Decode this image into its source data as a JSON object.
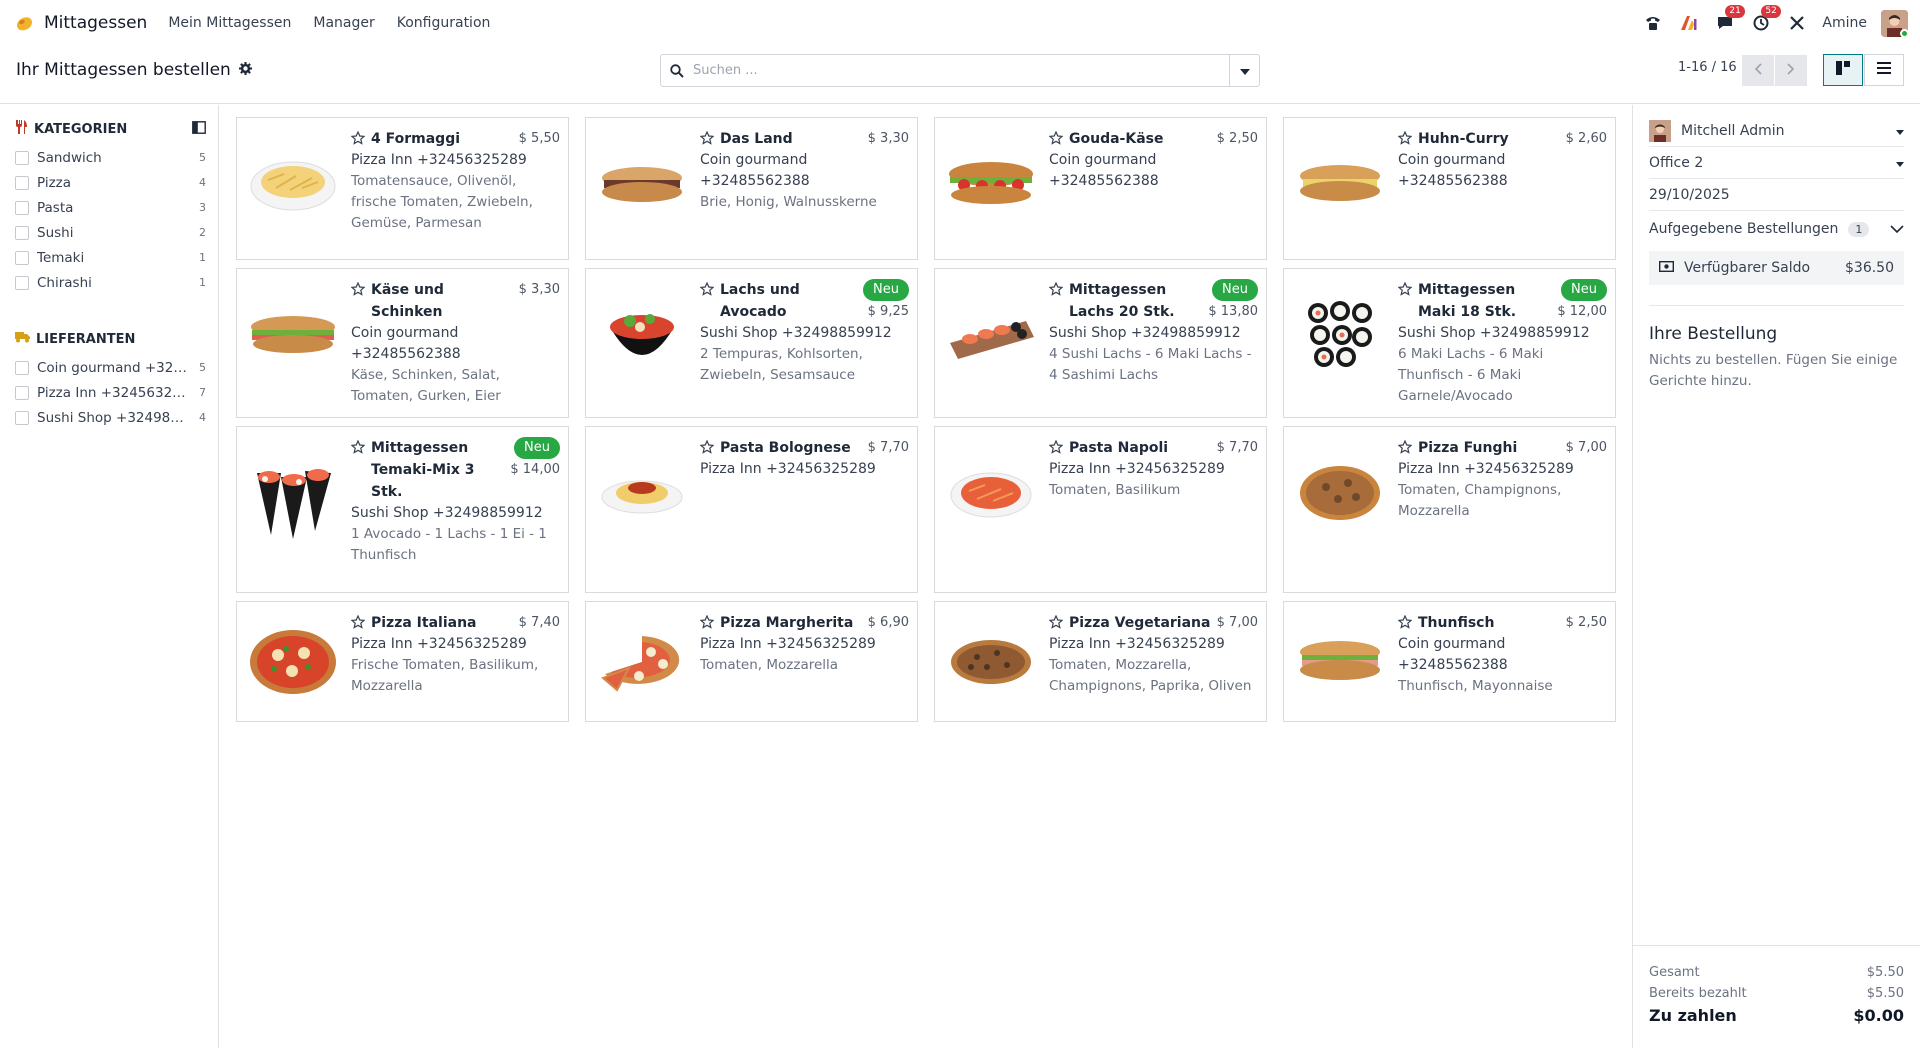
{
  "navbar": {
    "app_name": "Mittagessen",
    "menu": [
      "Mein Mittagessen",
      "Manager",
      "Konfiguration"
    ],
    "messages_count": "21",
    "activities_count": "52",
    "user_name": "Amine"
  },
  "control": {
    "title": "Ihr Mittagessen bestellen",
    "search_placeholder": "Suchen ...",
    "pager": "1-16 / 16"
  },
  "sidebar": {
    "categories_title": "KATEGORIEN",
    "categories": [
      {
        "label": "Sandwich",
        "count": "5"
      },
      {
        "label": "Pizza",
        "count": "4"
      },
      {
        "label": "Pasta",
        "count": "3"
      },
      {
        "label": "Sushi",
        "count": "2"
      },
      {
        "label": "Temaki",
        "count": "1"
      },
      {
        "label": "Chirashi",
        "count": "1"
      }
    ],
    "suppliers_title": "LIEFERANTEN",
    "suppliers": [
      {
        "label": "Coin gourmand +3248...",
        "count": "5"
      },
      {
        "label": "Pizza Inn +32456325289",
        "count": "7"
      },
      {
        "label": "Sushi Shop +3249885...",
        "count": "4"
      }
    ]
  },
  "products": [
    {
      "name": "4 Formaggi",
      "price": "$ 5,50",
      "new": "",
      "vendor": "Pizza Inn +32456325289",
      "desc": "Tomatensauce, Olivenöl, frische Tomaten, Zwiebeln, Gemüse, Parmesan"
    },
    {
      "name": "Das Land",
      "price": "$ 3,30",
      "new": "",
      "vendor": "Coin gourmand +32485562388",
      "desc": "Brie, Honig, Walnusskerne"
    },
    {
      "name": "Gouda-Käse",
      "price": "$ 2,50",
      "new": "",
      "vendor": "Coin gourmand +32485562388",
      "desc": ""
    },
    {
      "name": "Huhn-Curry",
      "price": "$ 2,60",
      "new": "",
      "vendor": "Coin gourmand +32485562388",
      "desc": ""
    },
    {
      "name": "Käse und Schinken",
      "price": "$ 3,30",
      "new": "",
      "vendor": "Coin gourmand +32485562388",
      "desc": "Käse, Schinken, Salat, Tomaten, Gurken, Eier"
    },
    {
      "name": "Lachs und Avocado",
      "price": "$ 9,25",
      "new": "Neu",
      "vendor": "Sushi Shop +32498859912",
      "desc": "2 Tempuras, Kohlsorten, Zwiebeln, Sesamsauce"
    },
    {
      "name": "Mittagessen Lachs 20 Stk.",
      "price": "$ 13,80",
      "new": "Neu",
      "vendor": "Sushi Shop +32498859912",
      "desc": "4 Sushi Lachs - 6 Maki Lachs - 4 Sashimi Lachs"
    },
    {
      "name": "Mittagessen Maki 18 Stk.",
      "price": "$ 12,00",
      "new": "Neu",
      "vendor": "Sushi Shop +32498859912",
      "desc": "6 Maki Lachs - 6 Maki Thunfisch - 6 Maki Garnele/Avocado"
    },
    {
      "name": "Mittagessen Temaki-Mix 3 Stk.",
      "price": "$ 14,00",
      "new": "Neu",
      "vendor": "Sushi Shop +32498859912",
      "desc": "1 Avocado - 1 Lachs - 1 Ei - 1 Thunfisch"
    },
    {
      "name": "Pasta Bolognese",
      "price": "$ 7,70",
      "new": "",
      "vendor": "Pizza Inn +32456325289",
      "desc": ""
    },
    {
      "name": "Pasta Napoli",
      "price": "$ 7,70",
      "new": "",
      "vendor": "Pizza Inn +32456325289",
      "desc": "Tomaten, Basilikum"
    },
    {
      "name": "Pizza Funghi",
      "price": "$ 7,00",
      "new": "",
      "vendor": "Pizza Inn +32456325289",
      "desc": "Tomaten, Champignons, Mozzarella"
    },
    {
      "name": "Pizza Italiana",
      "price": "$ 7,40",
      "new": "",
      "vendor": "Pizza Inn +32456325289",
      "desc": "Frische Tomaten, Basilikum, Mozzarella"
    },
    {
      "name": "Pizza Margherita",
      "price": "$ 6,90",
      "new": "",
      "vendor": "Pizza Inn +32456325289",
      "desc": "Tomaten, Mozzarella"
    },
    {
      "name": "Pizza Vegetariana",
      "price": "$ 7,00",
      "new": "",
      "vendor": "Pizza Inn +32456325289",
      "desc": "Tomaten, Mozzarella, Champignons, Paprika, Oliven"
    },
    {
      "name": "Thunfisch",
      "price": "$ 2,50",
      "new": "",
      "vendor": "Coin gourmand +32485562388",
      "desc": "Thunfisch, Mayonnaise"
    }
  ],
  "order_panel": {
    "user": "Mitchell Admin",
    "location": "Office 2",
    "date": "29/10/2025",
    "placed_orders_label": "Aufgegebene Bestellungen",
    "placed_orders_count": "1",
    "balance_label": "Verfügbarer Saldo",
    "balance_amount": "$36.50",
    "your_order_title": "Ihre Bestellung",
    "empty_message": "Nichts zu bestellen. Fügen Sie einige Gerichte hinzu.",
    "total_label": "Gesamt",
    "total_amount": "$5.50",
    "paid_label": "Bereits bezahlt",
    "paid_amount": "$5.50",
    "due_label": "Zu zahlen",
    "due_amount": "$0.00"
  },
  "colors": {
    "accent": "#017e84",
    "badge_new": "#28a745",
    "notification": "#d9363e"
  }
}
